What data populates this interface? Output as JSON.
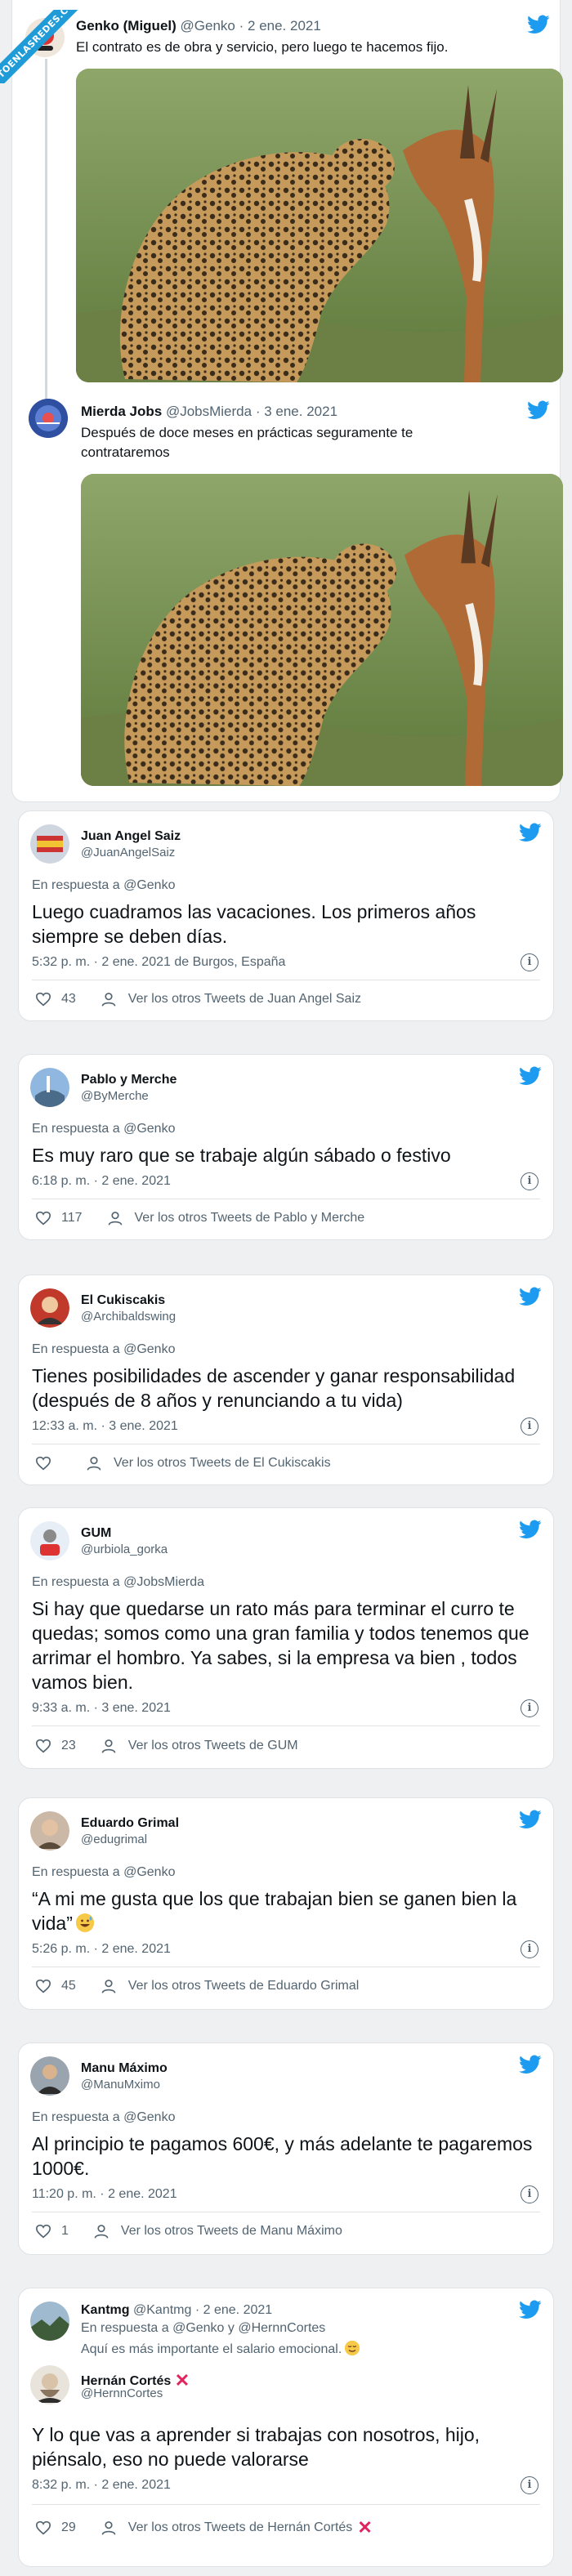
{
  "ribbon": {
    "label": "VISTOENLASREDES.COM"
  },
  "thread": [
    {
      "name": "Genko (Miguel)",
      "handle": "@Genko",
      "date": "2 ene. 2021",
      "text": "El contrato es de obra y servicio, pero luego te hacemos fijo."
    },
    {
      "name": "Mierda Jobs",
      "handle": "@JobsMierda",
      "date": "3 ene. 2021",
      "text": "Después de doce meses en prácticas seguramente te contrataremos"
    }
  ],
  "separator": "·",
  "reply_prefix": "En respuesta a",
  "tweets": [
    {
      "name": "Juan Angel Saiz",
      "handle": "@JuanAngelSaiz",
      "reply_to": "@Genko",
      "text": "Luego cuadramos las vacaciones. Los primeros años siempre se deben días.",
      "time": "5:32 p. m. · 2 ene. 2021 de Burgos, España",
      "likes": "43",
      "more": "Ver los otros Tweets de Juan Angel Saiz"
    },
    {
      "name": "Pablo y Merche",
      "handle": "@ByMerche",
      "reply_to": "@Genko",
      "text": "Es muy raro que se trabaje algún sábado o festivo",
      "time": "6:18 p. m. · 2 ene. 2021",
      "likes": "117",
      "more": "Ver los otros Tweets de Pablo y Merche"
    },
    {
      "name": "El Cukiscakis",
      "handle": "@Archibaldswing",
      "reply_to": "@Genko",
      "text": "Tienes posibilidades de ascender y ganar responsabilidad (después de 8 años y renunciando a tu vida)",
      "time": "12:33 a. m. · 3 ene. 2021",
      "likes": "",
      "more": "Ver los otros Tweets de El Cukiscakis"
    },
    {
      "name": "GUM",
      "handle": "@urbiola_gorka",
      "reply_to": "@JobsMierda",
      "text": "Si hay que quedarse un rato más para terminar  el curro te quedas; somos como una gran familia  y todos tenemos que arrimar el hombro. Ya sabes, si la empresa va bien , todos vamos bien.",
      "time": "9:33 a. m. · 3 ene. 2021",
      "likes": "23",
      "more": "Ver los otros Tweets de GUM"
    },
    {
      "name": "Eduardo Grimal",
      "handle": "@edugrimal",
      "reply_to": "@Genko",
      "text": "“A mi me gusta que los que trabajan bien se ganen bien la vida”",
      "time": "5:26 p. m. · 2 ene. 2021",
      "likes": "45",
      "more": "Ver los otros Tweets de Eduardo Grimal"
    },
    {
      "name": "Manu Máximo",
      "handle": "@ManuMximo",
      "reply_to": "@Genko",
      "text": "Al principio te pagamos 600€, y más adelante te pagaremos 1000€.",
      "time": "11:20 p. m. · 2 ene. 2021",
      "likes": "1",
      "more": "Ver los otros Tweets de Manu Máximo"
    }
  ],
  "last": {
    "quoted": {
      "name": "Kantmg",
      "handle": "@Kantmg",
      "date": "2 ene. 2021",
      "reply_line": "En respuesta a @Genko y @HernnCortes",
      "text": "Aquí es más importante el salario emocional."
    },
    "name": "Hernán Cortés",
    "handle": "@HernnCortes",
    "text": "Y lo que vas a aprender si trabajas con nosotros, hijo, piénsalo, eso no puede valorarse",
    "time": "8:32 p. m. · 2 ene. 2021",
    "likes": "29",
    "more": "Ver los otros Tweets de Hernán Cortés"
  },
  "colors": {
    "twitter_blue": "#1d9bf0",
    "muted": "#536471",
    "border": "#dfe3e6"
  },
  "icons": [
    "twitter-bird-icon",
    "heart-icon",
    "person-icon",
    "info-icon",
    "grinning-sweat-emoji",
    "cross-mark-emoji"
  ]
}
